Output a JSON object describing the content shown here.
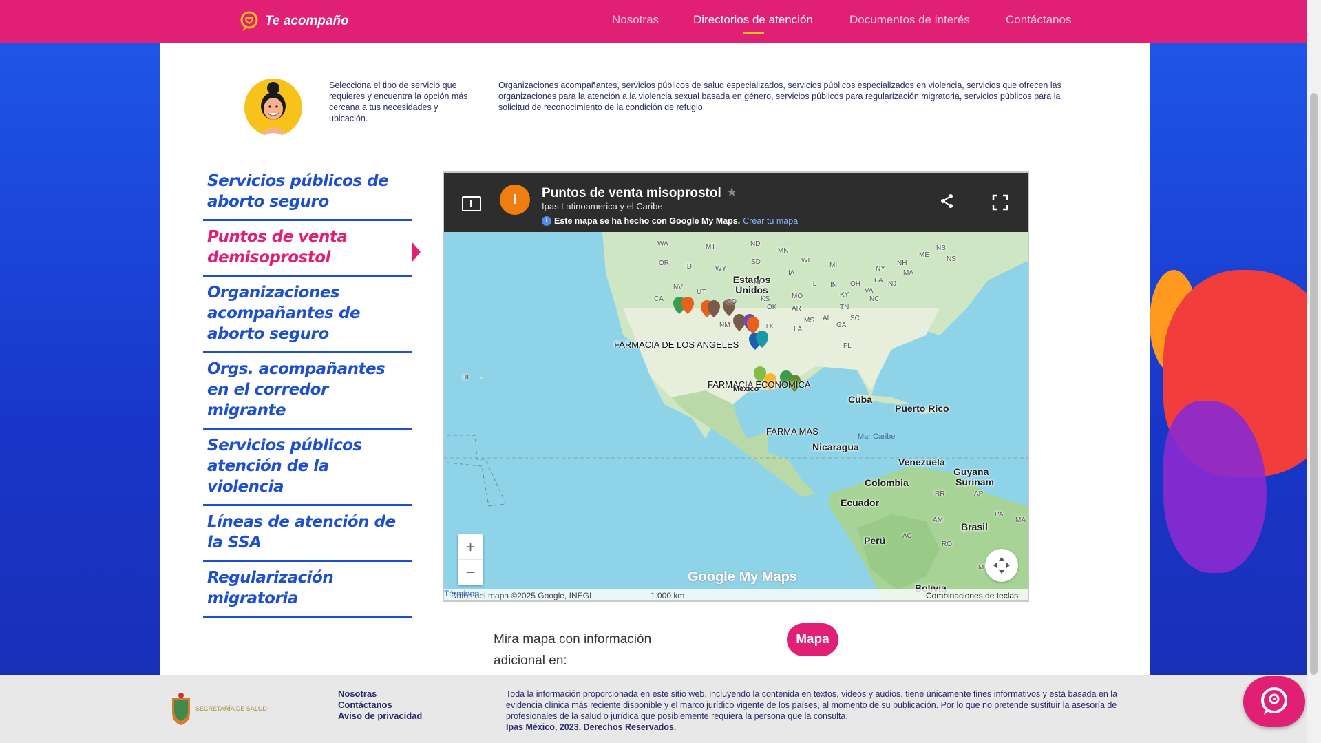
{
  "header": {
    "logo_text": "Te acompaño",
    "nav": [
      {
        "label": "Nosotras",
        "active": false
      },
      {
        "label": "Directorios de atención",
        "active": true
      },
      {
        "label": "Documentos de interés",
        "active": false
      },
      {
        "label": "Contáctanos",
        "active": false
      }
    ]
  },
  "intro": {
    "left": "Selecciona el tipo de servicio que requieres y encuentra la opción más cercana a tus necesidades y ubicación.",
    "right": "Organizaciones acompañantes, servicios públicos de salud especializados, servicios públicos especializados en violencia, servicios que ofrecen las organizaciones para la atención a la violencia sexual basada en género, servicios públicos para regularización migratoria, servicios públicos para la solicitud de reconocimiento de la condición de refugio."
  },
  "menu": {
    "items": [
      {
        "label": "Servicios públicos de aborto seguro",
        "active": false
      },
      {
        "label": "Puntos de venta demisoprostol",
        "active": true
      },
      {
        "label": "Organizaciones acompañantes de aborto seguro",
        "active": false
      },
      {
        "label": "Orgs. acompañantes en el corredor migrante",
        "active": false
      },
      {
        "label": "Servicios públicos atención de la violencia",
        "active": false
      },
      {
        "label": "Líneas de atención de la SSA",
        "active": false
      },
      {
        "label": "Regularización migratoria",
        "active": false
      }
    ]
  },
  "map": {
    "badge": "I",
    "title": "Puntos de venta misoprostol",
    "subtitle": "Ipas Latinoamerica y el Caribe",
    "note": "Este mapa se ha hecho con Google My Maps.",
    "note_link": "Crear tu mapa",
    "brand": "Google My Maps",
    "attribution": "Datos del mapa ©2025 Google, INEGI",
    "terms": "Términos",
    "scale": "1.000 km",
    "shortcuts": "Combinaciones de teclas",
    "zoom_in": "+",
    "zoom_out": "−",
    "labels": {
      "usa": "Estados Unidos",
      "farmacia_la": "FARMACIA DE LOS ANGELES",
      "farmacia_eco": "FARMACIA ECONOMICA",
      "farma_mas": "FARMA MAS",
      "cuba": "Cuba",
      "puerto_rico": "Puerto Rico",
      "mar_caribe": "Mar Caribe",
      "nicaragua": "Nicaragua",
      "venezuela": "Venezuela",
      "guyana": "Guyana",
      "surinam": "Surinam",
      "colombia": "Colombia",
      "ecuador": "Ecuador",
      "peru": "Perú",
      "brasil": "Brasil",
      "bolivia": "Bolivia",
      "mexico": "México",
      "hi": "HI"
    },
    "state_codes": [
      "WA",
      "MT",
      "ND",
      "MN",
      "OR",
      "ID",
      "WY",
      "SD",
      "WI",
      "MI",
      "NY",
      "MA",
      "NV",
      "UT",
      "CO",
      "KS",
      "MO",
      "IL",
      "IN",
      "OH",
      "PA",
      "NJ",
      "CA",
      "OK",
      "AR",
      "TN",
      "NC",
      "NM",
      "MS",
      "AL",
      "GA",
      "SC",
      "TX",
      "LA",
      "FL",
      "VA",
      "KY",
      "NE",
      "IA",
      "ME",
      "NH",
      "NB",
      "NS",
      "AP",
      "RR",
      "AM",
      "AC",
      "RO",
      "MT",
      "PA",
      "MA"
    ]
  },
  "cta": {
    "text": "Mira mapa con información adicional en:",
    "button": "Mapa"
  },
  "footer": {
    "logo_text": "SECRETARÍA DE SALUD",
    "links": [
      "Nosotras",
      "Contáctanos",
      "Aviso de privacidad"
    ],
    "disclaimer": "Toda la información proporcionada en este sitio web, incluyendo la contenida en textos, videos y audios, tiene únicamente fines informativos y está basada en la evidencia clínica más reciente disponible y el marco jurídico vigente de los países, al momento de su publicación. Por lo que no pretende sustituir la asesoría de profesionales de la salud o jurídica que posiblemente requiera la persona que la consulta.",
    "copyright": "Ipas México, 2023. Derechos Reservados."
  },
  "colors": {
    "brand_pink": "#e01f75",
    "brand_blue": "#1d4fd1",
    "accent_yellow": "#f7c31a"
  }
}
